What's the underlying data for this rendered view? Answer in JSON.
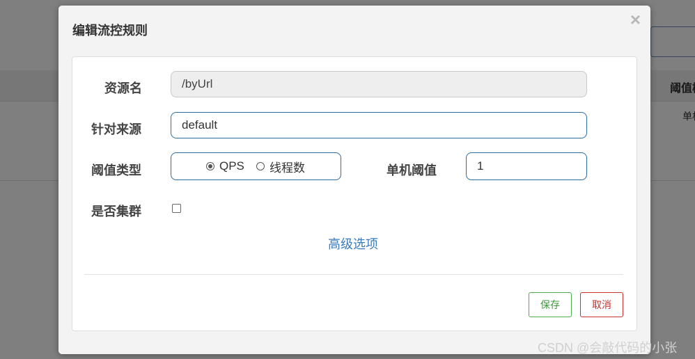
{
  "background": {
    "column_header": "阈值模",
    "cell_text": "单机"
  },
  "dialog": {
    "title": "编辑流控规则",
    "close_label": "×",
    "fields": {
      "resource": {
        "label": "资源名",
        "value": "/byUrl"
      },
      "source": {
        "label": "针对来源",
        "value": "default"
      },
      "threshold_type": {
        "label": "阈值类型",
        "options": [
          {
            "label": "QPS",
            "checked": true
          },
          {
            "label": "线程数",
            "checked": false
          }
        ]
      },
      "single_threshold": {
        "label": "单机阈值",
        "value": "1"
      },
      "cluster": {
        "label": "是否集群",
        "checked": false
      }
    },
    "advanced_link": "高级选项",
    "buttons": {
      "save": "保存",
      "cancel": "取消"
    }
  },
  "watermark": "CSDN @会敲代码的小张",
  "colors": {
    "primary_border": "#2e6da4",
    "save": "#4cae4c",
    "cancel": "#c9302c",
    "link": "#3a7bbf"
  }
}
